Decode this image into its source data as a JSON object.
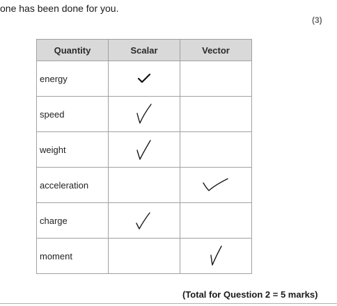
{
  "intro_text": "one has been done for you.",
  "marks_label": "(3)",
  "table": {
    "headers": [
      "Quantity",
      "Scalar",
      "Vector"
    ],
    "rows": [
      {
        "quantity": "energy",
        "scalar": true,
        "vector": false,
        "scalar_tick": "printed-tick-icon"
      },
      {
        "quantity": "speed",
        "scalar": true,
        "vector": false,
        "scalar_tick": "handwritten-tick-icon"
      },
      {
        "quantity": "weight",
        "scalar": true,
        "vector": false,
        "scalar_tick": "handwritten-tick-icon"
      },
      {
        "quantity": "acceleration",
        "scalar": false,
        "vector": true,
        "vector_tick": "handwritten-tick-icon"
      },
      {
        "quantity": "charge",
        "scalar": true,
        "vector": false,
        "scalar_tick": "handwritten-tick-icon"
      },
      {
        "quantity": "moment",
        "scalar": false,
        "vector": true,
        "vector_tick": "handwritten-tick-icon"
      }
    ]
  },
  "total_text": "(Total for Question 2 = 5 marks)"
}
